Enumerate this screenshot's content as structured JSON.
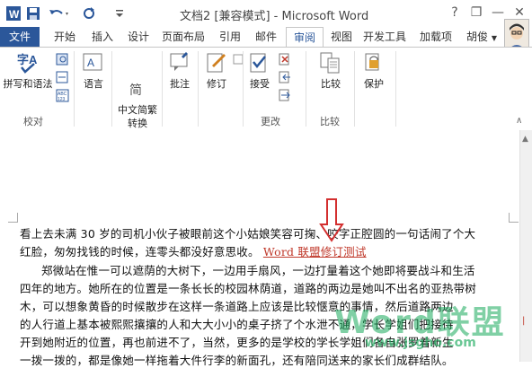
{
  "title": "文档2 [兼容模式] - Microsoft Word",
  "window_controls": [
    "?",
    "—",
    "❐",
    "✕"
  ],
  "tabs": {
    "file": "文件",
    "items": [
      "开始",
      "插入",
      "设计",
      "页面布局",
      "引用",
      "邮件",
      "审阅",
      "视图",
      "开发工具",
      "加载项"
    ],
    "active": "审阅",
    "user": "胡俊"
  },
  "ribbon": {
    "proofing": {
      "spell_label": "拼写和语法",
      "group": "校对"
    },
    "language": "语言",
    "chinese_conv": "中文简繁\n转换",
    "comment": "批注",
    "tracking": "修订",
    "accept": "接受",
    "changes_group": "更改",
    "compare": "比较",
    "compare_group": "比较",
    "protect": "保护"
  },
  "document": {
    "lines": [
      "看上去未满 30 岁的司机小伙子被眼前这个小姑娘笑容可掬、咬字正腔圆的一句话闹了个大",
      "红脸，匆匆找钱的时候，连零头都没好意思收。",
      "郑微站在惟一可以遮荫的大树下，一边用手扇风，一边打量着这个她即将要战斗和生活",
      "四年的地方。她所在的位置是一条长长的校园林荫道，道路的两边是她叫不出名的亚热带树",
      "木，可以想象黄昏的时候散步在这样一条道路上应该是比较惬意的事情，然后道路两边",
      "的人行道上基本被熙熙攘攘的人和大大小小的桌子挤了个水泄不通，学长学姐们把接待",
      "开到她附近的位置，再也前进不了，当然，更多的是学校的学长学姐们各自张罗着新生",
      "一拨一拨的，都是像她一样拖着大件行李的新面孔，还有陪同送来的家长们成群结队。"
    ],
    "inserted_text": "Word 联盟修订测试"
  },
  "watermark": {
    "text": "Word联盟",
    "url": "www.jsgho.com"
  },
  "colors": {
    "accent": "#2b579a",
    "insert": "#c0392b",
    "watermark": "#1aaa5c"
  }
}
